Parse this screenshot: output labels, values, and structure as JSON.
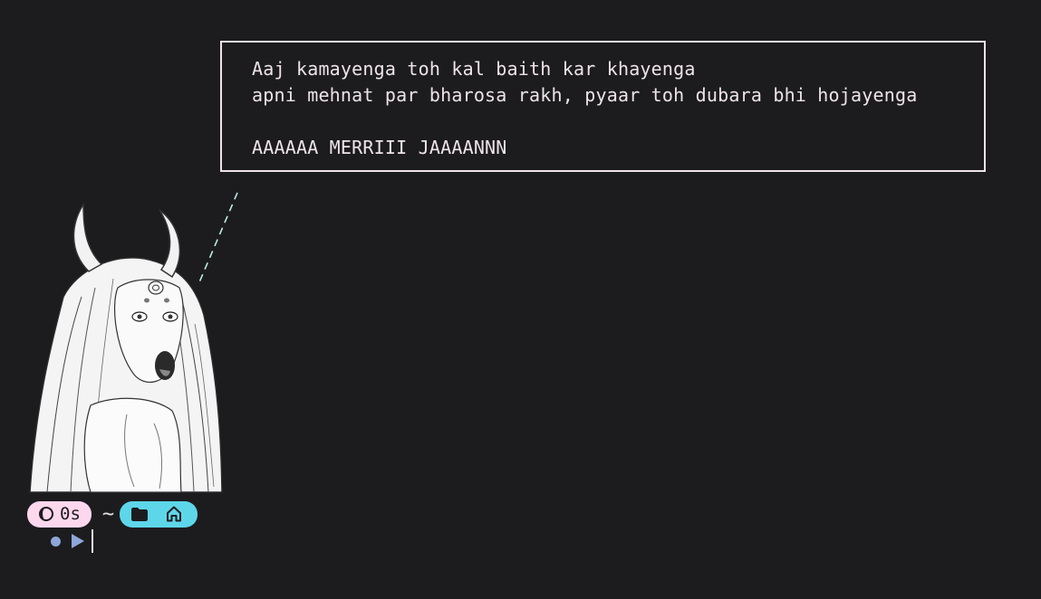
{
  "quote": {
    "line1": "Aaj kamayenga toh kal baith kar khayenga",
    "line2": "apni mehnat par bharosa rakh, pyaar toh dubara bhi hojayenga",
    "line3": "AAAAAA MERRIII JAAAANNN"
  },
  "prompt": {
    "time_icon": "half-moon-icon",
    "duration": "0s",
    "separator": "~",
    "dir_icons": [
      "folder-icon",
      "home-icon"
    ]
  },
  "input": {
    "indicator_icon": "dot-icon",
    "arrow_icon": "play-arrow-icon",
    "value": ""
  },
  "colors": {
    "background": "#1c1c1e",
    "text": "#eee3ea",
    "pink_pill": "#fcd7ee",
    "cyan_pill": "#5ed6ea",
    "prompt_accent": "#8ea6d8"
  }
}
